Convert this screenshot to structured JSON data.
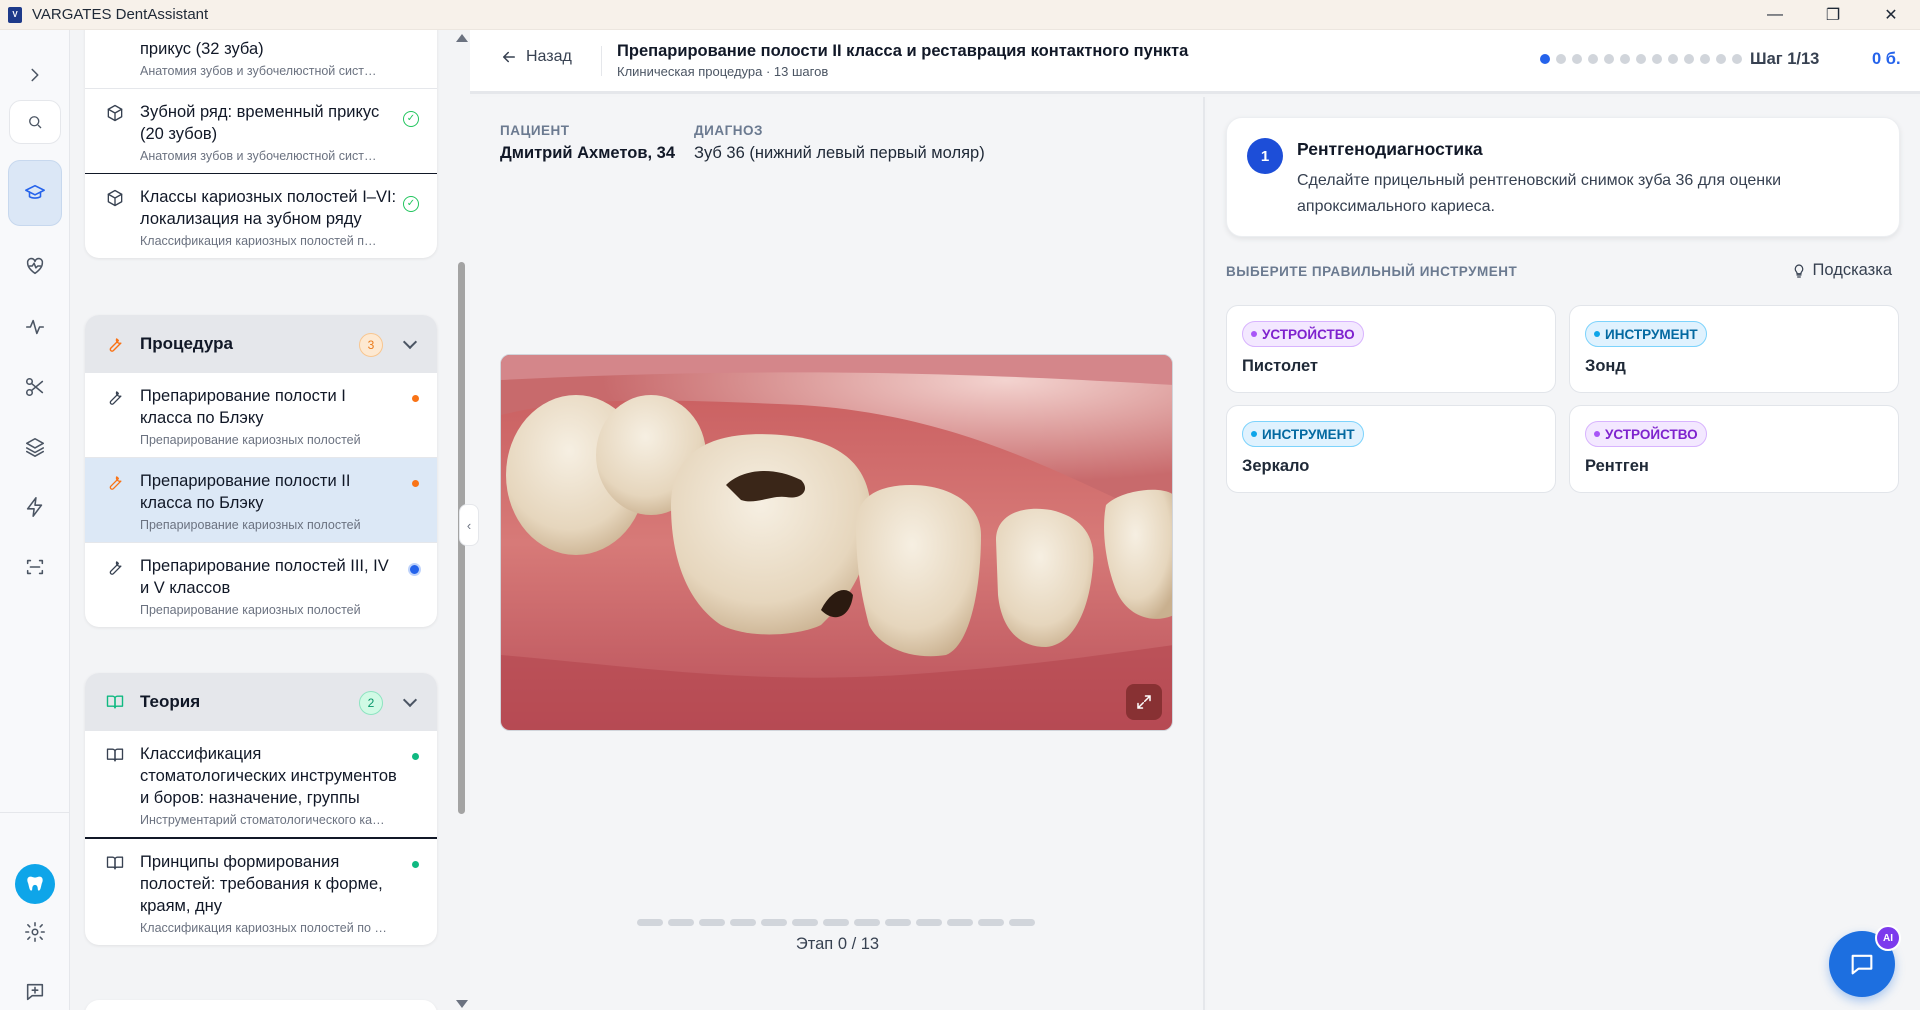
{
  "window": {
    "title": "VARGATES DentAssistant",
    "controls": [
      "—",
      "❐",
      "✕"
    ]
  },
  "sidebar": {
    "top_items": [
      {
        "title": "прикус (32 зуба)",
        "subtitle": "Анатомия зубов и зубочелюстной сист…"
      },
      {
        "title": "Зубной ряд: временный прикус (20 зубов)",
        "subtitle": "Анатомия зубов и зубочелюстной сист…"
      },
      {
        "title": "Классы кариозных полостей I–VI: локализация на зубном ряду",
        "subtitle": "Классификация кариозных полостей п…"
      }
    ],
    "procedure_group": {
      "title": "Процедура",
      "count": "3",
      "items": [
        {
          "title": "Препарирование полости I класса по Блэку",
          "subtitle": "Препарирование кариозных полостей"
        },
        {
          "title": "Препарирование полости II класса по Блэку",
          "subtitle": "Препарирование кариозных полостей"
        },
        {
          "title": "Препарирование полостей III, IV и V классов",
          "subtitle": "Препарирование кариозных полостей"
        }
      ]
    },
    "theory_group": {
      "title": "Теория",
      "count": "2",
      "items": [
        {
          "title": "Классификация стоматологических инструментов и боров: назначение, группы",
          "subtitle": "Инструментарий стоматологического ка…"
        },
        {
          "title": "Принципы формирования полостей: требования к форме, краям, дну",
          "subtitle": "Классификация кариозных полостей по …"
        }
      ]
    }
  },
  "header": {
    "back_label": "Назад",
    "title": "Препарирование полости II класса и реставрация контактного пункта",
    "subtitle": "Клиническая процедура · 13 шагов",
    "step_label": "Шаг 1/13",
    "score": "0 б.",
    "steps_total": 13,
    "steps_current": 1
  },
  "patient": {
    "patient_label": "ПАЦИЕНТ",
    "patient_name": "Дмитрий Ахметов, 34",
    "diagnosis_label": "ДИАГНОЗ",
    "diagnosis": "Зуб 36 (нижний левый первый моляр)",
    "stage_label": "Этап 0 / 13",
    "stages_total": 13
  },
  "task": {
    "number": "1",
    "title": "Рентгенодиагностика",
    "description": "Сделайте прицельный рентгеновский снимок зуба 36 для оценки апроксимального кариеса.",
    "choose_label": "ВЫБЕРИТЕ ПРАВИЛЬНЫЙ ИНСТРУМЕНТ",
    "hint_label": "Подсказка",
    "tools": [
      {
        "tag": "УСТРОЙСТВО",
        "kind": "device",
        "name": "Пистолет"
      },
      {
        "tag": "ИНСТРУМЕНТ",
        "kind": "tool",
        "name": "Зонд"
      },
      {
        "tag": "ИНСТРУМЕНТ",
        "kind": "tool",
        "name": "Зеркало"
      },
      {
        "tag": "УСТРОЙСТВО",
        "kind": "device",
        "name": "Рентген"
      }
    ]
  },
  "chat": {
    "ai_badge": "AI"
  },
  "colors": {
    "accent": "#2563eb",
    "orange": "#f97316",
    "green": "#10b981",
    "purple": "#7e22ce"
  }
}
